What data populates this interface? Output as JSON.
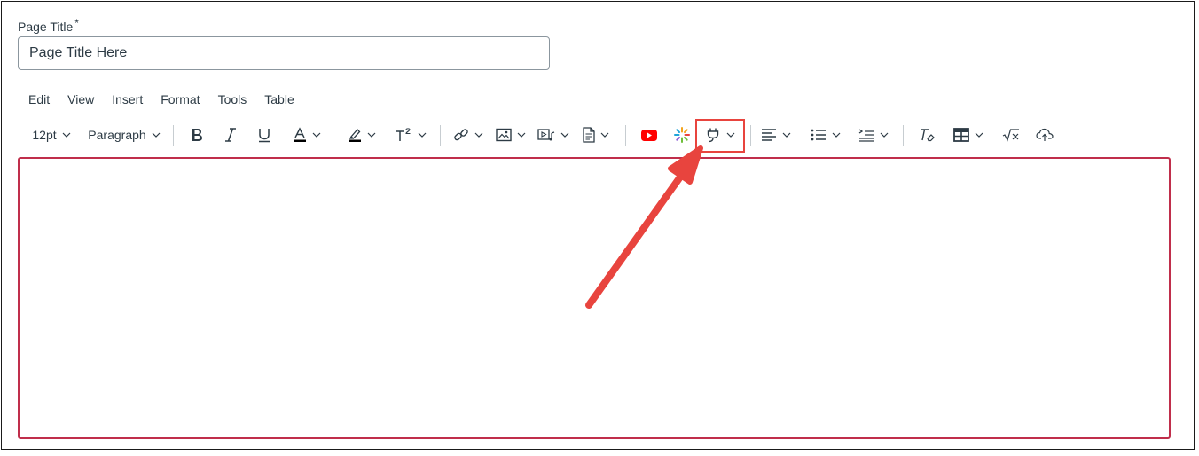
{
  "form": {
    "title_label": "Page Title",
    "required_mark": "*",
    "title_value": "Page Title Here"
  },
  "menubar": {
    "items": [
      "Edit",
      "View",
      "Insert",
      "Format",
      "Tools",
      "Table"
    ]
  },
  "toolbar": {
    "font_size": "12pt",
    "block_format": "Paragraph",
    "icons": [
      "bold-icon",
      "italic-icon",
      "underline-icon",
      "text-color-icon",
      "highlight-color-icon",
      "superscript-icon",
      "link-icon",
      "image-icon",
      "media-icon",
      "document-icon",
      "youtube-icon",
      "apps-icon",
      "plug-icon",
      "align-icon",
      "list-icon",
      "indent-icon",
      "clear-formatting-icon",
      "table-icon",
      "equation-icon",
      "cloud-upload-icon"
    ],
    "highlighted_tool": "plug-icon"
  },
  "colors": {
    "text": "#2d3b45",
    "editor_border": "#c02e4b",
    "annotation": "#e8443e",
    "youtube": "#ff0000"
  }
}
